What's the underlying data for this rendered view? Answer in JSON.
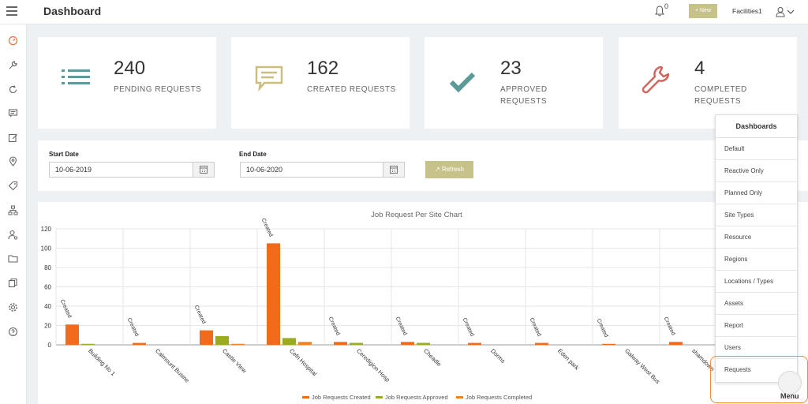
{
  "header": {
    "title": "Dashboard",
    "notification_count": "0",
    "new_button": "+ New",
    "user_name": "Facilities1"
  },
  "sidebar": {
    "icons": [
      "dashboard-icon",
      "wrench-icon",
      "refresh-icon",
      "message-icon",
      "edit-icon",
      "location-pin-icon",
      "tag-icon",
      "sitemap-icon",
      "user-settings-icon",
      "folder-icon",
      "copy-icon",
      "gear-icon",
      "help-icon"
    ]
  },
  "cards": [
    {
      "value": "240",
      "label": "PENDING REQUESTS",
      "icon": "list-icon",
      "color": "#5a9a98"
    },
    {
      "value": "162",
      "label": "CREATED REQUESTS",
      "icon": "comment-icon",
      "color": "#c9bd82"
    },
    {
      "value": "23",
      "label": "APPROVED REQUESTS",
      "icon": "check-icon",
      "color": "#5a9a98"
    },
    {
      "value": "4",
      "label": "COMPLETED REQUESTS",
      "icon": "wrench-icon",
      "color": "#d2665a"
    }
  ],
  "filters": {
    "start_label": "Start Date",
    "start_value": "10-06-2019",
    "end_label": "End Date",
    "end_value": "10-06-2020",
    "refresh_label": "Refresh"
  },
  "chart_data": {
    "type": "bar",
    "title": "Job Request Per Site Chart",
    "categories": [
      "Building No 1",
      "Calmount Busine",
      "Castle View",
      "Cefn Hospital",
      "Ceredigion Hosp",
      "Cheadle",
      "Dorms",
      "Eden park",
      "Galway West Bus",
      "shamdown"
    ],
    "series": [
      {
        "name": "Job Requests Created",
        "color": "#f26b1d",
        "values": [
          21,
          2,
          15,
          105,
          3,
          3,
          2,
          2,
          1,
          3
        ]
      },
      {
        "name": "Job Requests Approved",
        "color": "#9aab22",
        "values": [
          1,
          0,
          9,
          7,
          2,
          2,
          0,
          0,
          0,
          0
        ]
      },
      {
        "name": "Job Requests Completed",
        "color": "#f4811f",
        "values": [
          0,
          0,
          1,
          3,
          0,
          0,
          0,
          0,
          0,
          0
        ]
      }
    ],
    "bar_annotation": "Created",
    "ylim": [
      0,
      120
    ],
    "yticks": [
      0,
      20,
      40,
      60,
      80,
      100,
      120
    ],
    "grid": true,
    "legend": "bottom"
  },
  "menu": {
    "header": "Dashboards",
    "items": [
      "Default",
      "Reactive Only",
      "Planned Only",
      "Site Types",
      "Resource",
      "Regions",
      "Locations / Types",
      "Assets",
      "Report",
      "Users",
      "Requests"
    ],
    "fab_label": "Menu"
  }
}
